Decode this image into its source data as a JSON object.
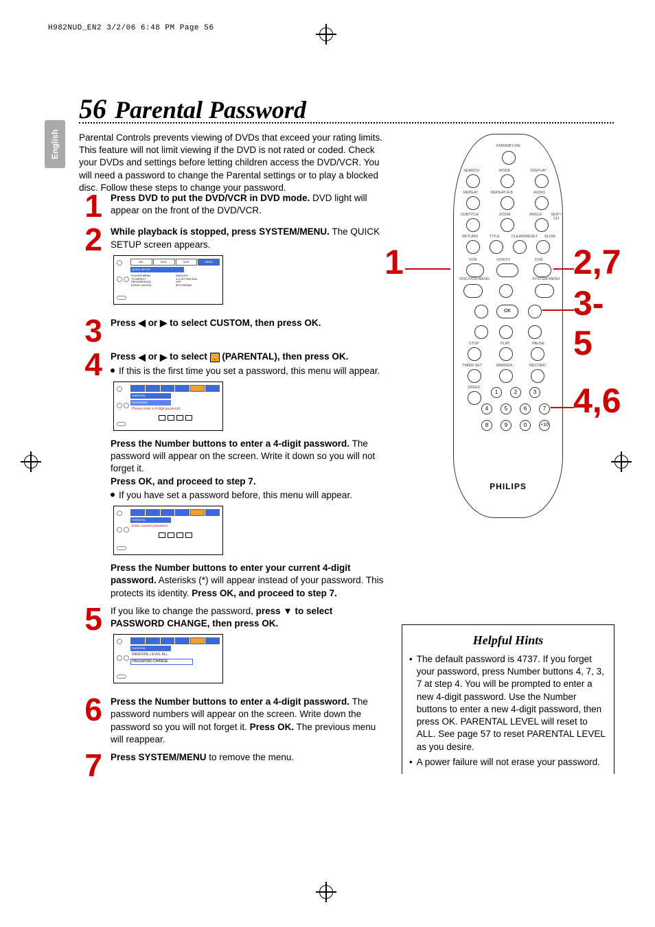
{
  "header_line": "H982NUD_EN2  3/2/06  6:48 PM  Page 56",
  "side_tab": "English",
  "page_number": "56",
  "page_title": "Parental Password",
  "intro": "Parental Controls prevents viewing of DVDs that exceed your rating limits. This feature will not limit viewing if the DVD is not rated or coded. Check your DVDs and settings before letting children access the DVD/VCR. You will need a password to change the Parental settings or to play a blocked disc. Follow these steps to change your password.",
  "steps": {
    "s1": {
      "num": "1",
      "b": "Press DVD to put the DVD/VCR in DVD mode.",
      "r": " DVD light will appear on the front of the DVD/VCR."
    },
    "s2": {
      "num": "2",
      "b": "While playback is stopped, press SYSTEM/MENU.",
      "r": " The QUICK SETUP screen appears."
    },
    "s3": {
      "num": "3",
      "pre": "Press ",
      "mid": " or ",
      "post": " to select CUSTOM, then press OK."
    },
    "s4": {
      "num": "4",
      "line1_pre": "Press ",
      "line1_mid": " or ",
      "line1_post": " to select ",
      "line1_end": " (PARENTAL), then press OK.",
      "bullet1": "If this is the first time you set a password, this menu will appear.",
      "b2": "Press the Number buttons to enter a 4-digit password.",
      "r2": " The password will appear on the screen. Write it down so you will not forget it.",
      "b3": "Press OK, and proceed to step 7.",
      "bullet2": "If you have set a password before, this menu will appear.",
      "b4_a": "Press the Number buttons to enter your current 4-digit password.",
      "r4": " Asterisks (*) will appear instead of your password. This protects its identity. ",
      "b4_b": "Press OK, and proceed to step 7."
    },
    "s5": {
      "num": "5",
      "pre": "If you like to change the password, ",
      "b": "press ▼ to select PASSWORD CHANGE, then press OK."
    },
    "s6": {
      "num": "6",
      "b1": "Press the Number buttons to enter a 4-digit password.",
      "r1": " The password numbers will appear on the screen. Write down the password so you will not forget it. ",
      "b2": "Press OK.",
      "r2": " The previous menu will reappear."
    },
    "s7": {
      "num": "7",
      "b": "Press SYSTEM/MENU",
      "r": " to remove the menu."
    }
  },
  "osd1": {
    "tabs": [
      "ALL",
      "DVD",
      "VCR",
      "MENU"
    ],
    "bar": "QUICK SETUP",
    "col1": [
      "PLAYER MENU",
      "TV ASPECT",
      "PROGRESSIVE",
      "DOLBY DIGITAL"
    ],
    "col2": [
      "ENGLISH",
      "4:3 LETTER BOX",
      "OFF",
      "BITSTREAM"
    ]
  },
  "osd2": {
    "bar": "PARENTAL",
    "bar2": "PASSWORD",
    "txt": "Please enter a 4-digit password."
  },
  "osd3": {
    "bar": "PARENTAL",
    "txt": "Enter current password."
  },
  "osd4": {
    "bar": "PARENTAL",
    "row1": "PARENTAL LEVEL   ALL",
    "row2": "PASSWORD CHANGE"
  },
  "remote": {
    "labels": [
      "STANDBY-ON",
      "SEARCH",
      "MODE",
      "DISPLAY",
      "REPEAT",
      "REPEAT A-B",
      "AUDIO",
      "SUBTITLE",
      "ZOOM",
      "ANGLE",
      "SKIP / CH",
      "RETURN",
      "TITLE",
      "CLEAR/RESET",
      "SLOW",
      "VCR",
      "VCR/TV",
      "DVD",
      "DISC/VCR MENU",
      "SYSTEM MENU",
      "OK",
      "STOP",
      "PLAY",
      "PAUSE",
      "TIMER SET",
      "MARKER",
      "RECORD",
      "SPEED"
    ],
    "brand": "PHILIPS",
    "numbers": [
      "1",
      "2",
      "3",
      "4",
      "5",
      "6",
      "7",
      "8",
      "9",
      "0",
      "+10"
    ]
  },
  "callouts": {
    "c1": "1",
    "c2": "2,7",
    "c3": "3-5",
    "c4": "4,6"
  },
  "hints": {
    "title": "Helpful Hints",
    "items": [
      "The default password is 4737. If you forget your password, press Number buttons 4, 7, 3, 7 at step 4. You will be prompted to enter a new 4-digit password. Use the Number buttons to enter a new 4-digit password, then press OK. PARENTAL LEVEL will reset to ALL. See page 57 to reset PARENTAL LEVEL as you desire.",
      "A power failure will not erase your password."
    ]
  }
}
